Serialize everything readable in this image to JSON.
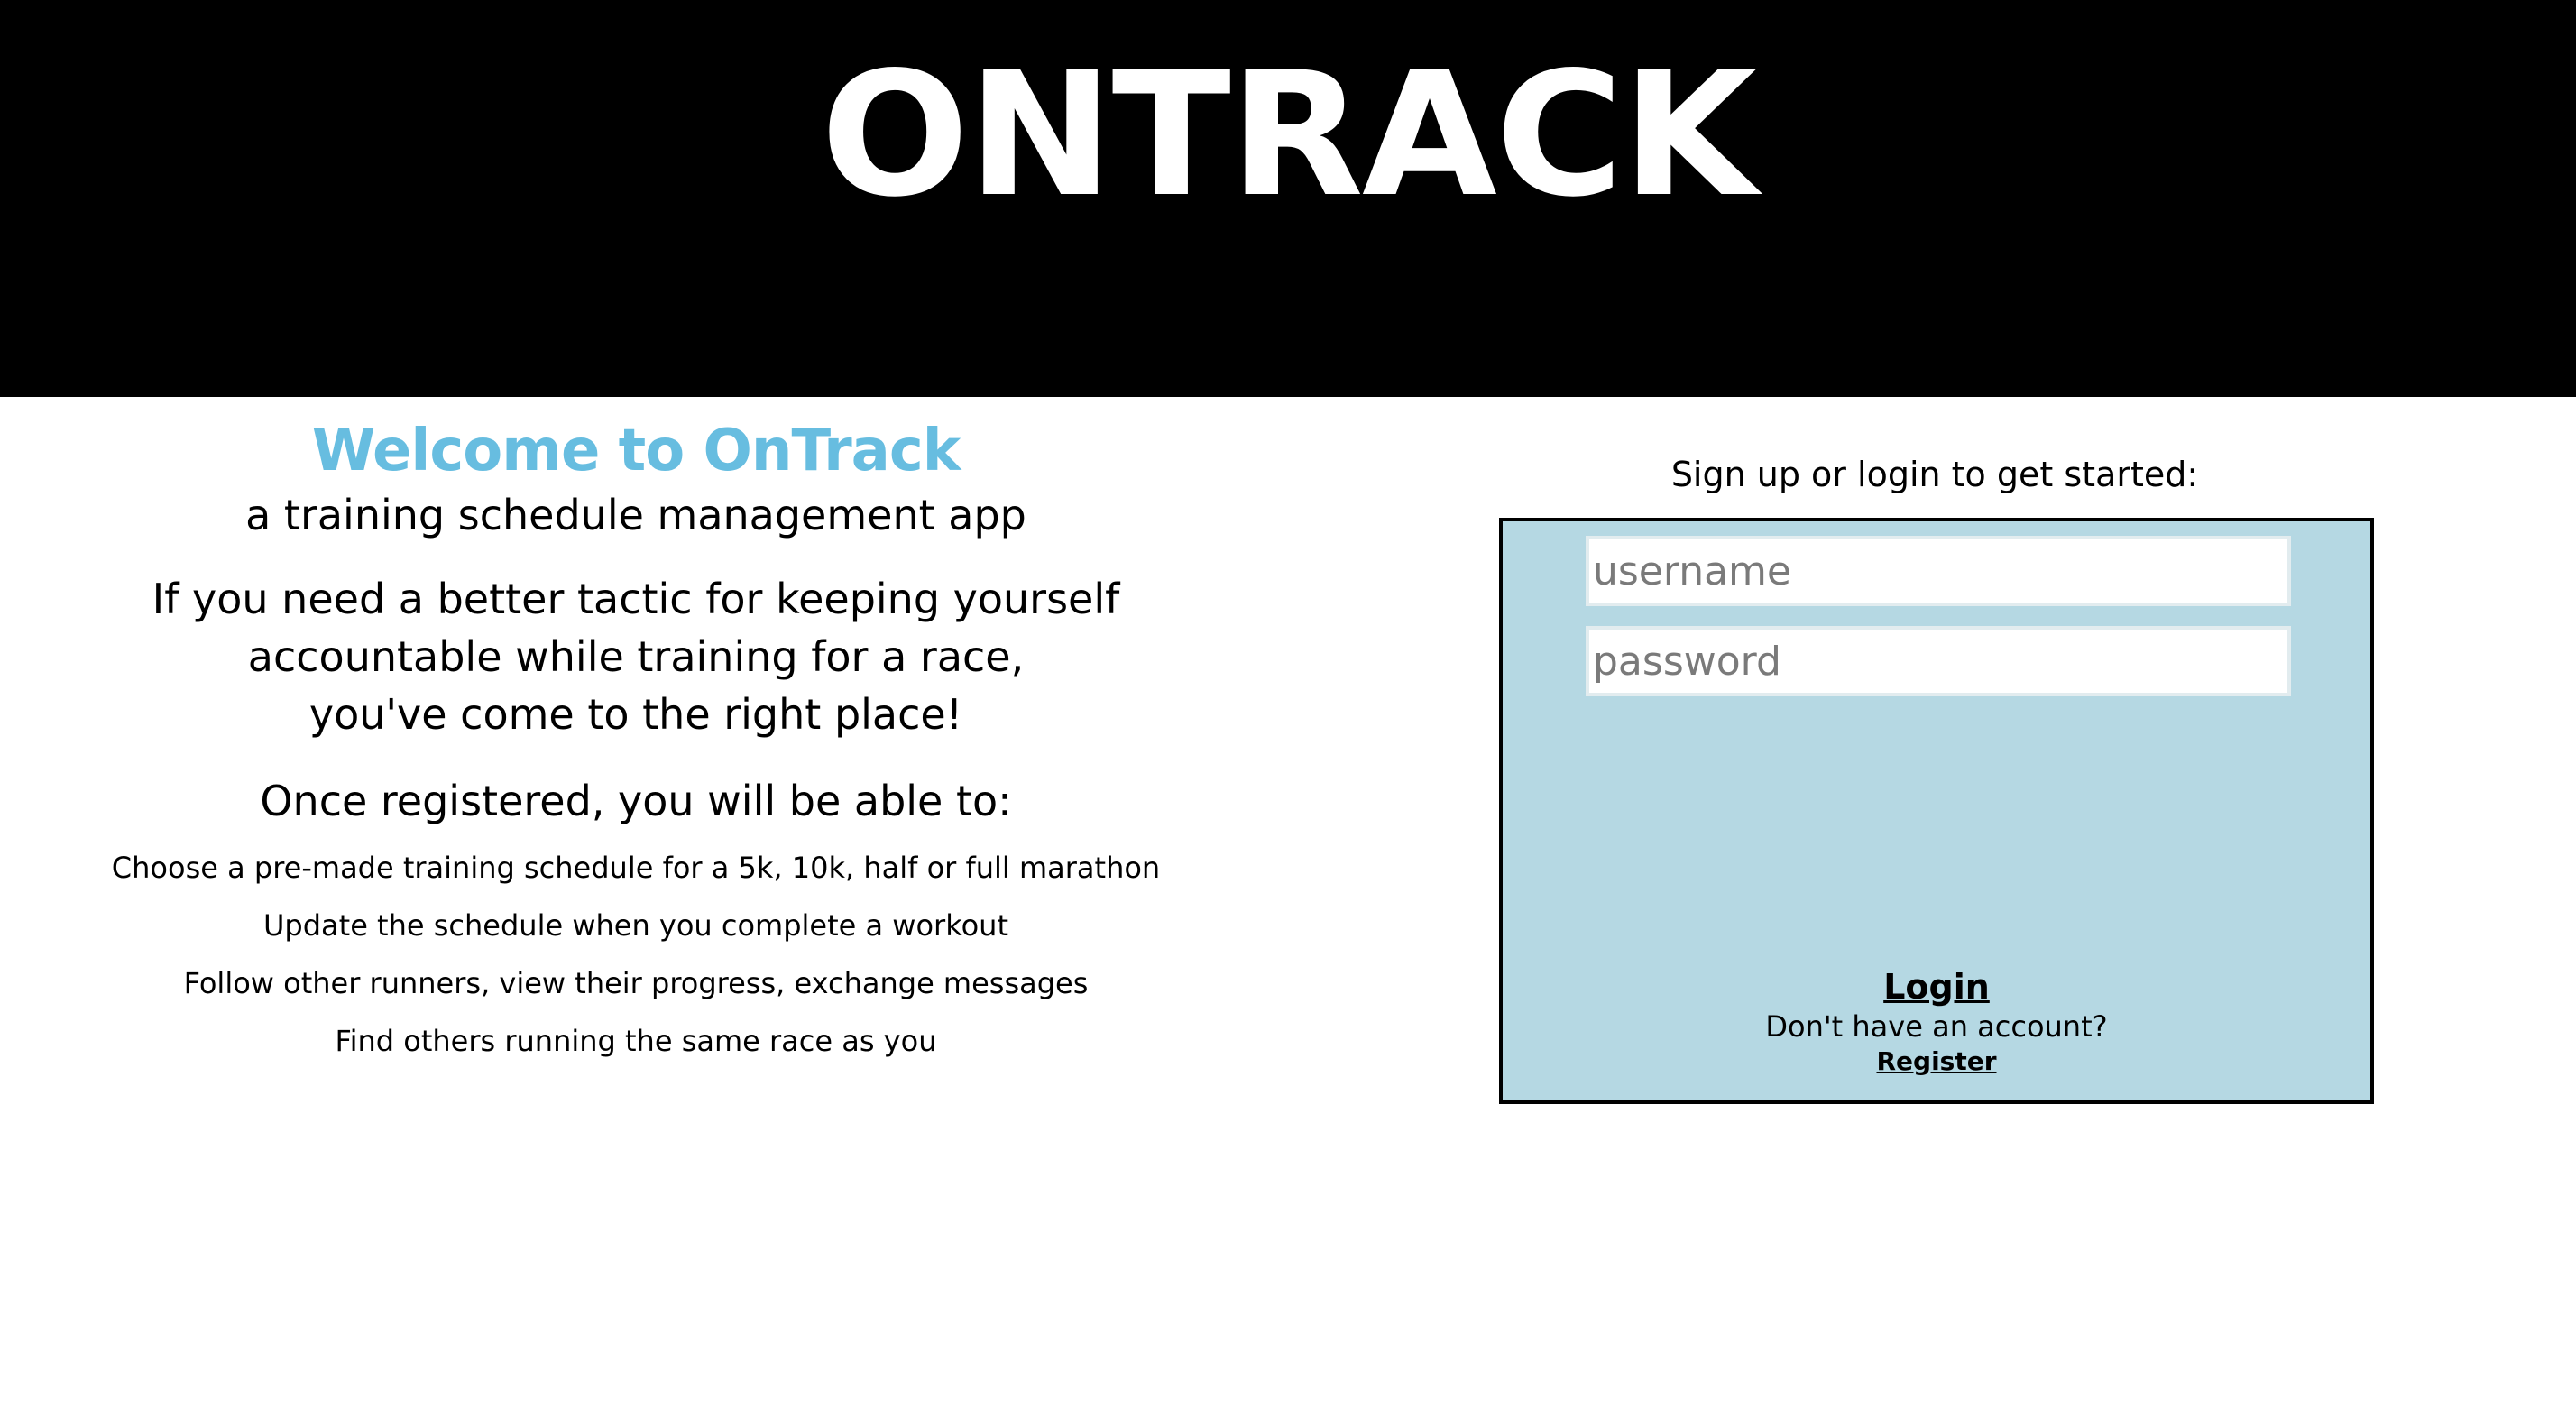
{
  "header": {
    "logo_text": "ONTRACK"
  },
  "intro": {
    "welcome": "Welcome to OnTrack",
    "subtitle": "a training schedule management app",
    "pitch_lines": [
      "If you need a better tactic for keeping yourself",
      "accountable while training for a race,",
      "you've come to the right place!"
    ],
    "once_registered": "Once registered, you will be able to:",
    "features": [
      "Choose a pre-made training schedule for a 5k, 10k, half or full marathon",
      "Update the schedule when you complete a workout",
      "Follow other runners, view their progress, exchange messages",
      "Find others running the same race as you"
    ]
  },
  "auth": {
    "prompt": "Sign up or login to get started:",
    "username_placeholder": "username",
    "password_placeholder": "password",
    "login_label": "Login",
    "no_account_text": "Don't have an account?",
    "register_label": "Register"
  },
  "colors": {
    "header_bg": "#000000",
    "welcome_accent": "#67bde0",
    "login_box_bg": "#b5d8e3"
  }
}
